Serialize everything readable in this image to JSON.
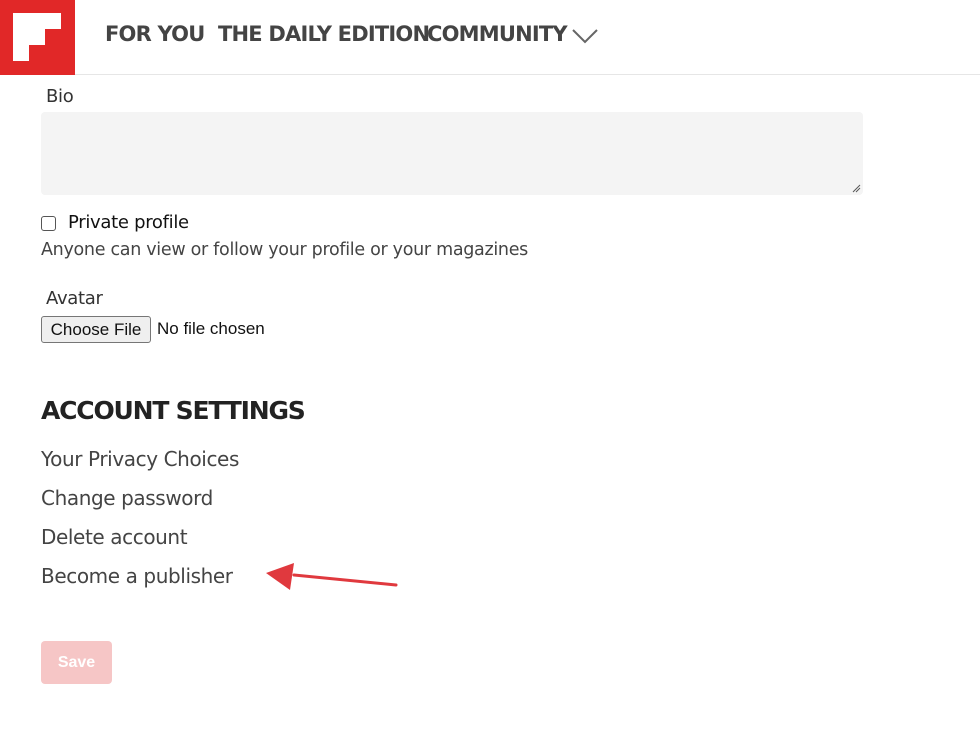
{
  "colors": {
    "brand_red": "#e12828",
    "annotation_arrow": "#e0393e",
    "save_disabled_bg": "#f6c6c6"
  },
  "header": {
    "logo_icon": "flipboard-logo-icon",
    "nav": [
      {
        "label": "FOR YOU"
      },
      {
        "label": "THE DAILY EDITION"
      },
      {
        "label": "COMMUNITY"
      }
    ],
    "more_icon": "chevron-down-icon"
  },
  "profile_form": {
    "bio_label": "Bio",
    "bio_value": "",
    "private_profile": {
      "label": "Private profile",
      "checked": false,
      "helper": "Anyone can view or follow your profile or your magazines"
    },
    "avatar": {
      "label": "Avatar",
      "button_label": "Choose File",
      "status": "No file chosen"
    }
  },
  "account_settings": {
    "heading": "ACCOUNT SETTINGS",
    "links": [
      {
        "label": "Your Privacy Choices"
      },
      {
        "label": "Change password"
      },
      {
        "label": "Delete account"
      },
      {
        "label": "Become a publisher"
      }
    ]
  },
  "annotation": {
    "icon": "red-arrow-pointer-icon"
  },
  "save_button": {
    "label": "Save",
    "disabled": true
  }
}
